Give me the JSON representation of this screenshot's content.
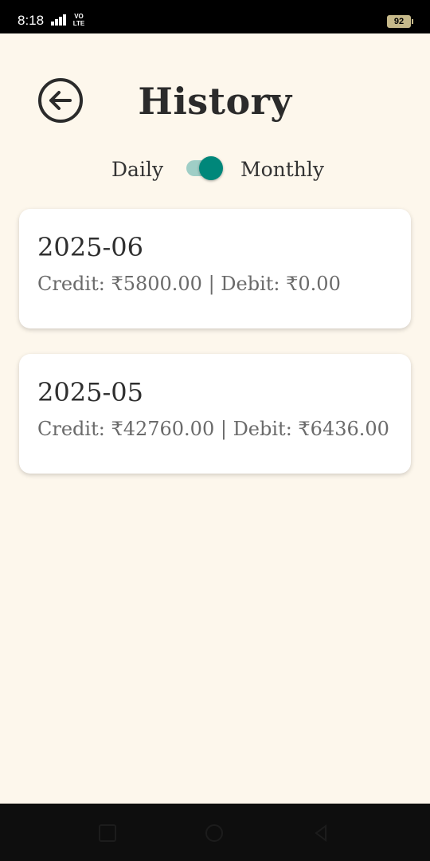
{
  "status_bar": {
    "time": "8:18",
    "network_label_top": "VO",
    "network_label_bottom": "LTE",
    "battery": "92"
  },
  "header": {
    "title": "History",
    "back_icon": "arrow-left-circle-icon"
  },
  "toggle": {
    "left_label": "Daily",
    "right_label": "Monthly",
    "selected": "Monthly",
    "accent_color": "#00877a"
  },
  "history": [
    {
      "period": "2025-06",
      "summary": "Credit: ₹5800.00 | Debit: ₹0.00"
    },
    {
      "period": "2025-05",
      "summary": "Credit: ₹42760.00 | Debit: ₹6436.00"
    }
  ],
  "nav_bar": {
    "icons": [
      "recent-apps-icon",
      "home-icon",
      "back-icon"
    ]
  }
}
